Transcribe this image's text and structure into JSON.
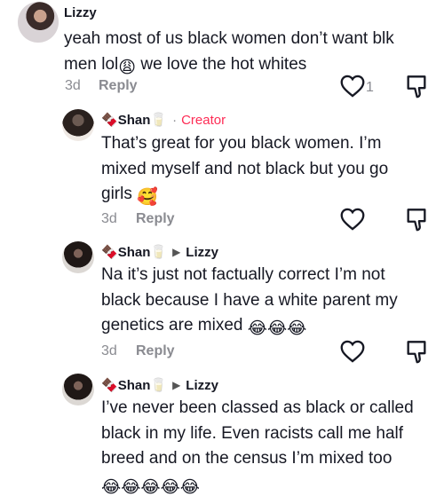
{
  "comments": [
    {
      "username": "Lizzy",
      "text_line1": "yeah most of us black women don’t want blk",
      "text_line2a": "men lol",
      "text_line2_emoji": "😩",
      "text_line2b": " we love the hot whites",
      "time": "3d",
      "reply_label": "Reply",
      "like_count": "1"
    },
    {
      "username": "Shan",
      "name_emoji": "🍫",
      "name_emoji2": "🥛",
      "badge": "Creator",
      "text_line1": "That’s great for you black women. I’m",
      "text_line2": "mixed myself and not black but you go",
      "text_line3": "girls",
      "text_line3_emoji": "🥰",
      "time": "3d",
      "reply_label": "Reply"
    },
    {
      "username": "Shan",
      "name_emoji": "🍫",
      "name_emoji2": "🥛",
      "reply_to": "Lizzy",
      "text_line1": "Na it’s just not factually correct I’m not",
      "text_line2": "black because I have a white parent my",
      "text_line3": "genetics are mixed",
      "text_line3_emoji": "😂😂😂",
      "time": "3d",
      "reply_label": "Reply"
    },
    {
      "username": "Shan",
      "name_emoji": "🍫",
      "name_emoji2": "🥛",
      "reply_to": "Lizzy",
      "text_line1": "I’ve never been classed as black or called",
      "text_line2": "black in my life. Even racists call me half",
      "text_line3": "breed and on the census I’m mixed too",
      "text_line4_emoji": "😂😂😂😂😂"
    }
  ],
  "icons": {
    "heart": "heart-icon",
    "dislike": "dislike-icon",
    "arrow": "caret-right-icon"
  }
}
